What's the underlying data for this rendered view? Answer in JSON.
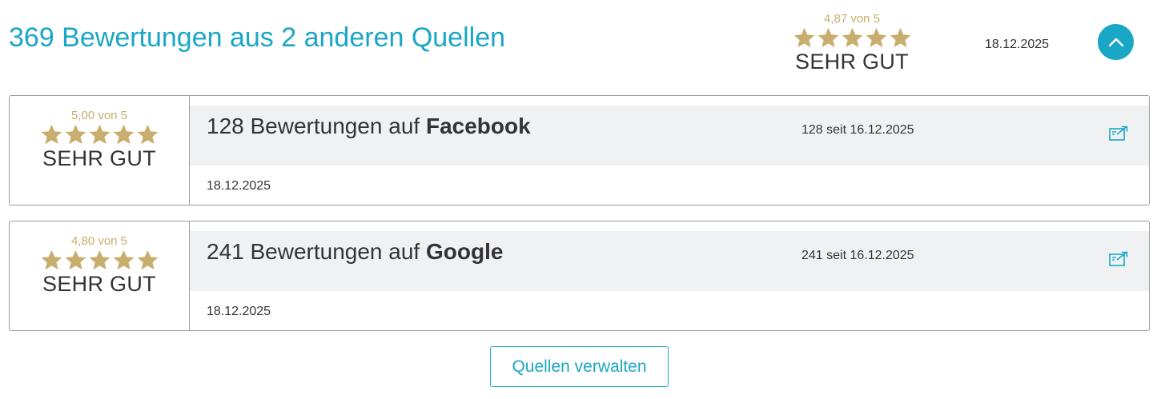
{
  "header": {
    "title": "369 Bewertungen aus 2 anderen Quellen",
    "rating_value": "4,87 von 5",
    "stars": 5,
    "rating_label": "SEHR GUT",
    "date": "18.12.2025",
    "collapse_icon": "chevron-up-icon"
  },
  "sources": [
    {
      "rating_value": "5,00 von 5",
      "stars": 5,
      "rating_label": "SEHR GUT",
      "title_prefix": "128 Bewertungen auf ",
      "platform": "Facebook",
      "since": "128 seit 16.12.2025",
      "date": "18.12.2025",
      "link_icon": "external-link-icon"
    },
    {
      "rating_value": "4,80 von 5",
      "stars": 5,
      "rating_label": "SEHR GUT",
      "title_prefix": "241 Bewertungen auf ",
      "platform": "Google",
      "since": "241 seit 16.12.2025",
      "date": "18.12.2025",
      "link_icon": "external-link-icon"
    }
  ],
  "actions": {
    "manage_label": "Quellen verwalten"
  },
  "colors": {
    "accent": "#1aa7c6",
    "star": "#c9ad6d",
    "band": "#f0f1f3",
    "border": "#9a9a9a"
  }
}
